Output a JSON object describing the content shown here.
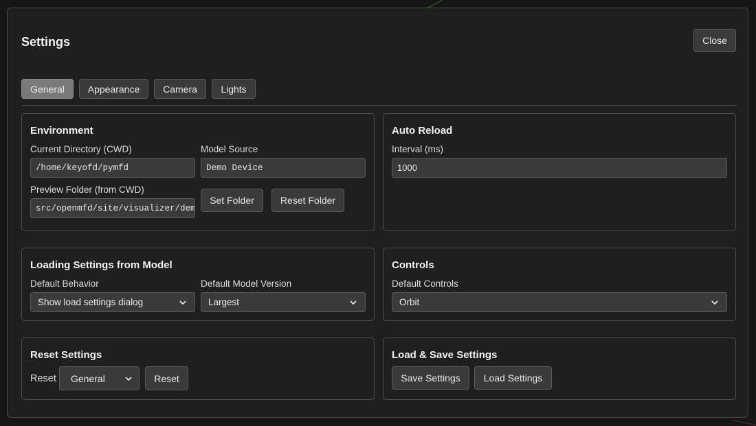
{
  "dialog": {
    "title": "Settings",
    "close_label": "Close"
  },
  "tabs": [
    {
      "label": "General",
      "active": true
    },
    {
      "label": "Appearance",
      "active": false
    },
    {
      "label": "Camera",
      "active": false
    },
    {
      "label": "Lights",
      "active": false
    }
  ],
  "environment": {
    "title": "Environment",
    "cwd_label": "Current Directory (CWD)",
    "cwd_value": "/home/keyofd/pymfd",
    "model_source_label": "Model Source",
    "model_source_value": "Demo Device",
    "preview_label": "Preview Folder (from CWD)",
    "preview_value": "src/openmfd/site/visualizer/demo",
    "set_folder_label": "Set Folder",
    "reset_folder_label": "Reset Folder"
  },
  "auto_reload": {
    "title": "Auto Reload",
    "interval_label": "Interval (ms)",
    "interval_value": "1000"
  },
  "loading": {
    "title": "Loading Settings from Model",
    "behavior_label": "Default Behavior",
    "behavior_value": "Show load settings dialog",
    "version_label": "Default Model Version",
    "version_value": "Largest"
  },
  "controls": {
    "title": "Controls",
    "default_label": "Default Controls",
    "default_value": "Orbit"
  },
  "reset": {
    "title": "Reset Settings",
    "prefix_label": "Reset",
    "scope_value": "General",
    "button_label": "Reset"
  },
  "load_save": {
    "title": "Load & Save Settings",
    "save_label": "Save Settings",
    "load_label": "Load Settings"
  },
  "colors": {
    "background": "#151515",
    "dialog": "#1f1f1f",
    "active_tab": "#7a7a7a",
    "button": "#3a3a3a"
  }
}
